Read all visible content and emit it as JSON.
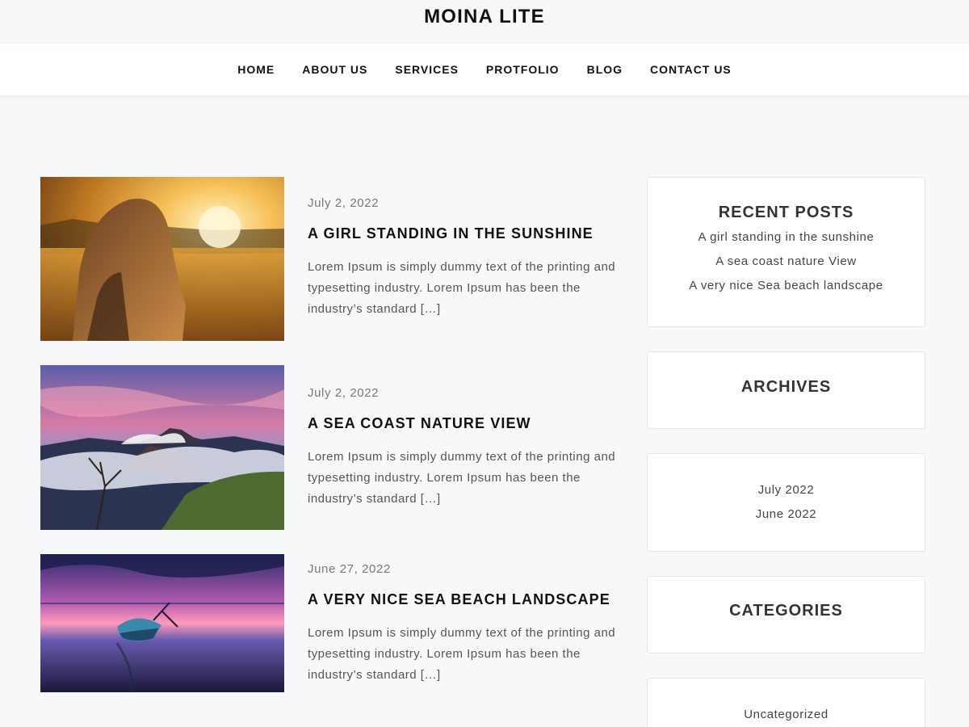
{
  "site": {
    "title": "MOINA LITE"
  },
  "nav": {
    "items": [
      {
        "label": "HOME"
      },
      {
        "label": "ABOUT US"
      },
      {
        "label": "SERVICES"
      },
      {
        "label": "PROTFOLIO"
      },
      {
        "label": "BLOG"
      },
      {
        "label": "CONTACT US"
      }
    ]
  },
  "posts": [
    {
      "date": "July 2, 2022",
      "title": "A GIRL STANDING IN THE SUNSHINE",
      "excerpt": "Lorem Ipsum is simply dummy text of the printing and typesetting industry. Lorem Ipsum has been the industry’s standard […]"
    },
    {
      "date": "July 2, 2022",
      "title": "A SEA COAST NATURE VIEW",
      "excerpt": "Lorem Ipsum is simply dummy text of the printing and typesetting industry. Lorem Ipsum has been the industry’s standard […]"
    },
    {
      "date": "June 27, 2022",
      "title": "A VERY NICE SEA BEACH LANDSCAPE",
      "excerpt": "Lorem Ipsum is simply dummy text of the printing and typesetting industry. Lorem Ipsum has been the industry’s standard […]"
    }
  ],
  "sidebar": {
    "recent_posts": {
      "title": "RECENT POSTS",
      "items": [
        "A girl standing in the sunshine",
        "A sea coast nature View",
        "A very nice Sea beach landscape"
      ]
    },
    "archives": {
      "title": "ARCHIVES",
      "items": [
        "July 2022",
        "June 2022"
      ]
    },
    "categories": {
      "title": "CATEGORIES",
      "items": [
        "Uncategorized"
      ]
    }
  },
  "colors": {
    "page_background": "#f7f8fa",
    "nav_background": "#ffffff",
    "text_primary": "#111111",
    "text_muted": "#777777",
    "widget_border": "#e2e4e8"
  }
}
